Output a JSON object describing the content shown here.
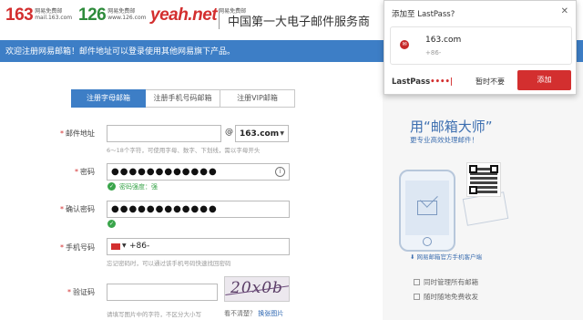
{
  "header": {
    "logo_163": {
      "big": "163",
      "sub1": "网易免费邮",
      "sub2": "mail.163.com"
    },
    "logo_126": {
      "big": "126",
      "sub1": "网易免费邮",
      "sub2": "www.126.com"
    },
    "logo_yeah": {
      "big": "yeah.net",
      "sub1": "网易免费邮"
    },
    "slogan": "中国第一大电子邮件服务商"
  },
  "banner": {
    "text": "欢迎注册网易邮箱！邮件地址可以登录使用其他网易旗下产品。"
  },
  "tabs": [
    {
      "label": "注册字母邮箱",
      "active": true
    },
    {
      "label": "注册手机号码邮箱",
      "active": false
    },
    {
      "label": "注册VIP邮箱",
      "active": false
    }
  ],
  "form": {
    "email": {
      "label": "邮件地址",
      "required": "*",
      "value": "",
      "at": "@",
      "domain": "163.com",
      "hint": "6～18个字符，可使用字母、数字、下划线，需以字母开头"
    },
    "password": {
      "label": "密码",
      "required": "*",
      "value": "●●●●●●●●●●●●",
      "strength": "密码强度：强"
    },
    "confirm": {
      "label": "确认密码",
      "required": "*",
      "value": "●●●●●●●●●●●●"
    },
    "phone": {
      "label": "手机号码",
      "required": "*",
      "value": "+86-",
      "hint": "忘记密码时，可以通过该手机号码快速找回密码"
    },
    "captcha": {
      "label": "验证码",
      "required": "*",
      "value": "",
      "hint": "请填写图片中的字符，不区分大小写",
      "image_text": "20x0b",
      "unclear": "看不清楚？",
      "refresh": "换张图片"
    }
  },
  "promo": {
    "title": "用“邮箱大师”",
    "subtitle": "更专业高效处理邮件！",
    "link": "网易邮箱官方手机客户端",
    "features": [
      "同时管理所有邮箱",
      "随时随地免费收发"
    ]
  },
  "lastpass": {
    "title": "添加至 LastPass?",
    "site": "163.com",
    "user": "+86-",
    "logo": "LastPass",
    "logo_dots": "••••|",
    "not_now": "暂时不要",
    "add": "添加"
  }
}
